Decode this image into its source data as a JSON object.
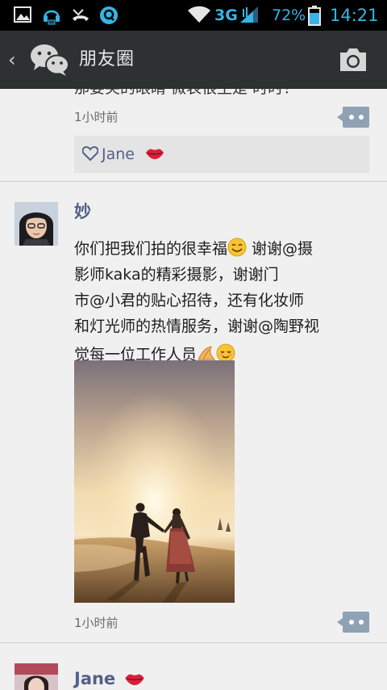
{
  "status_bar": {
    "network": "3G",
    "battery": "72%",
    "time": "14:21",
    "icons": [
      "image-icon",
      "headset-icon",
      "missed-call-icon",
      "q-app-icon",
      "wifi-icon",
      "signal-icon",
      "battery-icon"
    ]
  },
  "header": {
    "title": "朋友圈",
    "back_icon": "chevron-left-icon",
    "logo_icon": "wechat-logo-icon",
    "camera_icon": "camera-icon"
  },
  "feed": {
    "cut_off_text": "那要突的眼睛 微表很生是 时时！",
    "posts": [
      {
        "time": "1小时前",
        "likes": [
          "Jane"
        ],
        "like_emoji": "lips-emoji"
      },
      {
        "author": "妙",
        "text_lines": [
          "你们把我们拍的很幸福",
          " 谢谢@摄",
          "影师kaka的精彩摄影，谢谢门",
          "市@小君的贴心招待，还有化妆师",
          "和灯光师的热情服务，谢谢@陶野视",
          "觉每一位工作人员"
        ],
        "emojis": [
          "smile-emoji",
          "bow-hands-emoji",
          "blush-emoji"
        ],
        "photo": "couple-on-beach-at-sunset",
        "time": "1小时前"
      },
      {
        "author": "Jane",
        "author_emoji": "lips-emoji"
      }
    ]
  },
  "colors": {
    "status_bar": "#000000",
    "status_accent": "#34b5e5",
    "title_bar": "#2e3132",
    "feed_bg": "#f0f0f0",
    "name_link": "#52618a",
    "comment_button": "#8fa2b4",
    "likes_bg": "#e4e4e4"
  }
}
